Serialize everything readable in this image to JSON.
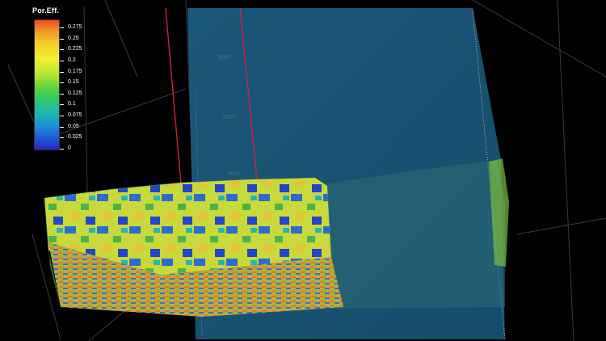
{
  "legend": {
    "title": "Por.Eff.",
    "ticks": [
      "0.275",
      "0.25",
      "0.225",
      "0.2",
      "0.175",
      "0.15",
      "0.125",
      "0.1",
      "0.075",
      "0.05",
      "0.025",
      "0"
    ]
  },
  "section_labels": [
    "8000",
    "8800",
    "9600"
  ],
  "colors": {
    "background": "#000000",
    "seismic_panel": "#1c5f82",
    "well_track": "#d0203e",
    "grid_line": "#6a6a6a"
  }
}
